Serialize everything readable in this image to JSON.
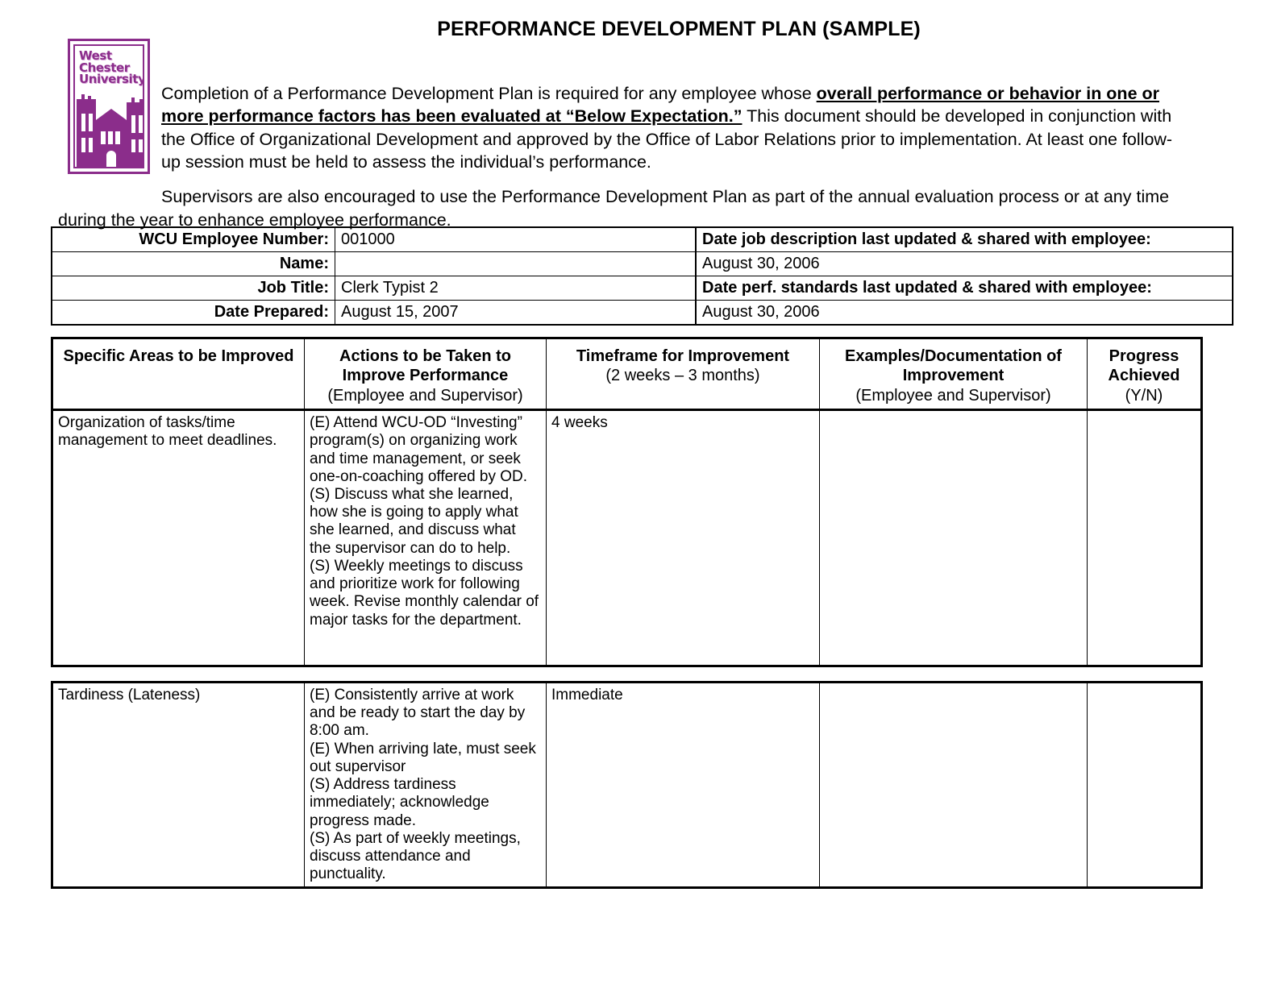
{
  "logo": {
    "alt_name": "west-chester-university-logo",
    "line1": "West",
    "line2": "Chester",
    "line3": "University",
    "color": "#8B2D8B"
  },
  "header": {
    "title": "PERFORMANCE DEVELOPMENT PLAN (SAMPLE)",
    "paragraph1_part1": "Completion of a Performance Development Plan is required for any employee whose ",
    "paragraph1_emphasis": "overall performance or behavior in one or more performance factors has been evaluated at “Below Expectation.”",
    "paragraph1_part2": "  This document should be developed in conjunction with the Office of Organizational Development and approved by the Office of Labor Relations prior to implementation.  At least one follow-up session must be held to assess the individual’s performance.",
    "paragraph2": "Supervisors are also encouraged to use the Performance Development Plan as part of the annual evaluation process or at any time during the year to enhance employee performance."
  },
  "info": {
    "rows": [
      {
        "label": "WCU Employee Number:",
        "value": "001000",
        "right": "Date job description last updated & shared with employee:",
        "right_bold": true
      },
      {
        "label": "Name:",
        "value": "",
        "right": "August 30, 2006",
        "right_bold": false
      },
      {
        "label": "Job Title:",
        "value": "Clerk Typist 2",
        "right": "Date perf. standards last updated & shared with employee:",
        "right_bold": true
      },
      {
        "label": "Date Prepared:",
        "value": "August 15, 2007",
        "right": "August 30, 2006",
        "right_bold": false
      }
    ]
  },
  "plan": {
    "columns": [
      {
        "main": "Specific Areas to be Improved",
        "sub": ""
      },
      {
        "main": "Actions to be Taken to Improve Performance",
        "sub": "(Employee and Supervisor)"
      },
      {
        "main": "Timeframe for Improvement",
        "sub": "(2 weeks – 3 months)"
      },
      {
        "main": "Examples/Documentation of Improvement",
        "sub": "(Employee and Supervisor)"
      },
      {
        "main": "Progress Achieved",
        "sub": "(Y/N)"
      }
    ],
    "rows": [
      {
        "area": "Organization of tasks/time management to meet deadlines.",
        "actions": "(E)  Attend WCU-OD “Investing” program(s) on organizing work and time management, or seek one-on-coaching offered by OD.\n(S) Discuss what she learned, how she is going to apply what she learned, and discuss what the supervisor can do to help.\n(S) Weekly meetings to discuss and prioritize work for following week. Revise monthly calendar of major tasks for the department.",
        "timeframe": "4 weeks",
        "examples": "",
        "progress": ""
      },
      {
        "area": "Tardiness (Lateness)",
        "actions": "(E) Consistently arrive at work and be ready to start the day by 8:00 am.\n(E) When arriving late, must seek out supervisor\n(S) Address tardiness immediately; acknowledge progress made.\n(S) As part of weekly meetings, discuss attendance and punctuality.",
        "timeframe": "Immediate",
        "examples": "",
        "progress": ""
      }
    ]
  }
}
